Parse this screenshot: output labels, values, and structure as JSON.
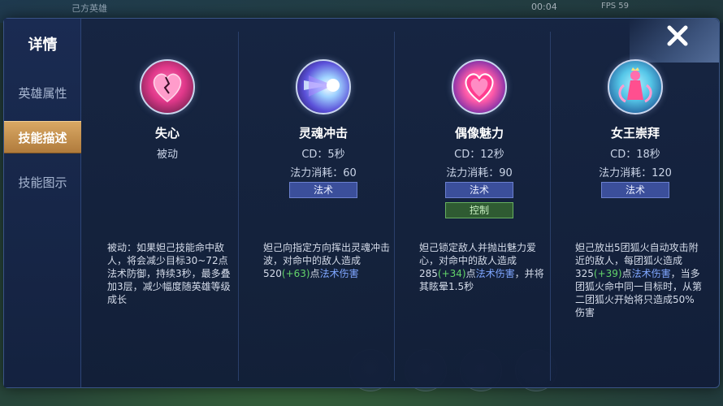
{
  "backdrop": {
    "ally_label": "己方英雄",
    "timer": "00:04",
    "fps": "FPS 59"
  },
  "sidebar": {
    "title": "详情",
    "tabs": [
      {
        "label": "英雄属性",
        "active": false
      },
      {
        "label": "技能描述",
        "active": true
      },
      {
        "label": "技能图示",
        "active": false
      }
    ]
  },
  "skills": [
    {
      "name": "失心",
      "line1": "被动",
      "icon": "broken-heart-icon",
      "desc": "被动：如果妲己技能命中敌人，将会减少目标30~72点法术防御，持续3秒，最多叠加3层，减少幅度随英雄等级成长"
    },
    {
      "name": "灵魂冲击",
      "line1": "CD：5秒",
      "line2": "法力消耗：60",
      "tag": "法术",
      "icon": "soul-blast-icon",
      "desc_parts": [
        "妲己向指定方向挥出灵魂冲击波，对命中的敌人造成520",
        "(+63)",
        "点",
        "法术伤害"
      ]
    },
    {
      "name": "偶像魅力",
      "line1": "CD：12秒",
      "line2": "法力消耗：90",
      "tag": "法术",
      "tag2": "控制",
      "icon": "charm-heart-icon",
      "desc_parts": [
        "妲己锁定敌人并抛出魅力爱心，对命中的敌人造成285",
        "(+34)",
        "点",
        "法术伤害",
        "，并将其眩晕1.5秒"
      ]
    },
    {
      "name": "女王崇拜",
      "line1": "CD：18秒",
      "line2": "法力消耗：120",
      "tag": "法术",
      "icon": "fox-queen-icon",
      "desc_parts": [
        "妲己放出5团狐火自动攻击附近的敌人，每团狐火造成325",
        "(+39)",
        "点",
        "法术伤害",
        "，当多团狐火命中同一目标时，从第二团狐火开始将只造成50%伤害"
      ]
    }
  ],
  "colors": {
    "accent_gold": "#d9a864",
    "tag_blue": "#3b4f9b",
    "tag_green": "#2f5b32",
    "bonus_green": "#63d46a",
    "magic_blue": "#7fa6ff"
  }
}
